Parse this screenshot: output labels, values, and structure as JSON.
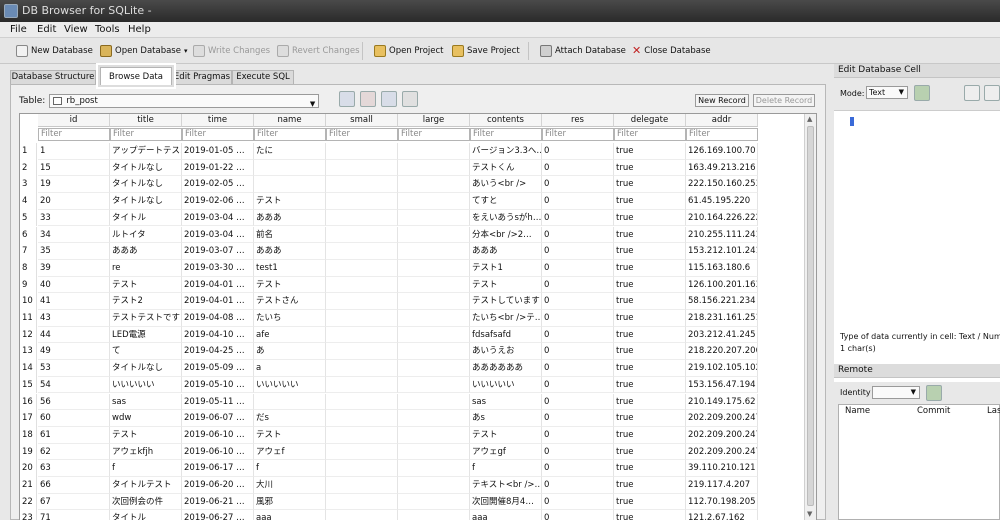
{
  "window": {
    "title": "DB Browser for SQLite -"
  },
  "menu": [
    "File",
    "Edit",
    "View",
    "Tools",
    "Help"
  ],
  "toolbar": {
    "new_db": "New Database",
    "open_db": "Open Database",
    "write_changes": "Write Changes",
    "revert_changes": "Revert Changes",
    "open_project": "Open Project",
    "save_project": "Save Project",
    "attach_db": "Attach Database",
    "close_db": "Close Database"
  },
  "tabs": [
    "Database Structure",
    "Browse Data",
    "Edit Pragmas",
    "Execute SQL"
  ],
  "browse": {
    "table_label": "Table:",
    "table_name": "rb_post",
    "new_record": "New Record",
    "delete_record": "Delete Record",
    "filter_placeholder": "Filter",
    "columns": [
      "id",
      "title",
      "time",
      "name",
      "small",
      "large",
      "contents",
      "res",
      "delegate",
      "addr"
    ],
    "rows": [
      [
        "1",
        "1",
        "アップデートテス…",
        "2019-01-05 …",
        "たに",
        "",
        "",
        "バージョン3.3へ…",
        "0",
        "true",
        "126.169.100.70"
      ],
      [
        "2",
        "15",
        "タイトルなし",
        "2019-01-22 …",
        "",
        "",
        "",
        "テストくん",
        "0",
        "true",
        "163.49.213.216"
      ],
      [
        "3",
        "19",
        "タイトルなし",
        "2019-02-05 …",
        "",
        "",
        "",
        "あいう<br />",
        "0",
        "true",
        "222.150.160.253"
      ],
      [
        "4",
        "20",
        "タイトルなし",
        "2019-02-06 …",
        "テスト",
        "",
        "",
        "てすと",
        "0",
        "true",
        "61.45.195.220"
      ],
      [
        "5",
        "33",
        "タイトル",
        "2019-03-04 …",
        "あああ",
        "",
        "",
        "をえいあうsがh…",
        "0",
        "true",
        "210.164.226.222"
      ],
      [
        "6",
        "34",
        "ルトイタ",
        "2019-03-04 …",
        "前名",
        "",
        "",
        "分本<br />2…",
        "0",
        "true",
        "210.255.111.241"
      ],
      [
        "7",
        "35",
        "あああ",
        "2019-03-07 …",
        "あああ",
        "",
        "",
        "あああ",
        "0",
        "true",
        "153.212.101.241"
      ],
      [
        "8",
        "39",
        "re",
        "2019-03-30 …",
        "test1",
        "",
        "",
        "テスト1",
        "0",
        "true",
        "115.163.180.6"
      ],
      [
        "9",
        "40",
        "テスト",
        "2019-04-01 …",
        "テスト",
        "",
        "",
        "テスト",
        "0",
        "true",
        "126.100.201.163"
      ],
      [
        "10",
        "41",
        "テスト2",
        "2019-04-01 …",
        "テストさん",
        "",
        "",
        "テストしています",
        "0",
        "true",
        "58.156.221.234"
      ],
      [
        "11",
        "43",
        "テストテストですと",
        "2019-04-08 …",
        "たいち",
        "",
        "",
        "たいち<br />テ…",
        "0",
        "true",
        "218.231.161.251"
      ],
      [
        "12",
        "44",
        "LED電源",
        "2019-04-10 …",
        "afe",
        "",
        "",
        "fdsafsafd",
        "0",
        "true",
        "203.212.41.245"
      ],
      [
        "13",
        "49",
        "て",
        "2019-04-25 …",
        "あ",
        "",
        "",
        "あいうえお",
        "0",
        "true",
        "218.220.207.206"
      ],
      [
        "14",
        "53",
        "タイトルなし",
        "2019-05-09 …",
        "a",
        "",
        "",
        "ああああああ",
        "0",
        "true",
        "219.102.105.102"
      ],
      [
        "15",
        "54",
        "いいいいい",
        "2019-05-10 …",
        "いいいいい",
        "",
        "",
        "いいいいい",
        "0",
        "true",
        "153.156.47.194"
      ],
      [
        "16",
        "56",
        "sas",
        "2019-05-11 …",
        "",
        "",
        "",
        "sas",
        "0",
        "true",
        "210.149.175.62"
      ],
      [
        "17",
        "60",
        "wdw",
        "2019-06-07 …",
        "だs",
        "",
        "",
        "あs",
        "0",
        "true",
        "202.209.200.247"
      ],
      [
        "18",
        "61",
        "テスト",
        "2019-06-10 …",
        "テスト",
        "",
        "",
        "テスト",
        "0",
        "true",
        "202.209.200.247"
      ],
      [
        "19",
        "62",
        "アウェkfjh",
        "2019-06-10 …",
        "アウェf",
        "",
        "",
        "アウェgf",
        "0",
        "true",
        "202.209.200.247"
      ],
      [
        "20",
        "63",
        "f",
        "2019-06-17 …",
        "f",
        "",
        "",
        "f",
        "0",
        "true",
        "39.110.210.121"
      ],
      [
        "21",
        "66",
        "タイトルテスト",
        "2019-06-20 …",
        "大川",
        "",
        "",
        "テキスト<br />…",
        "0",
        "true",
        "219.117.4.207"
      ],
      [
        "22",
        "67",
        "次回例会の件",
        "2019-06-21 …",
        "風邪",
        "",
        "",
        "次回開催8月4…",
        "0",
        "true",
        "112.70.198.205"
      ],
      [
        "23",
        "71",
        "タイトル",
        "2019-06-27 …",
        "aaa",
        "",
        "",
        "aaa",
        "0",
        "true",
        "121.2.67.162"
      ]
    ]
  },
  "edit_cell": {
    "title": "Edit Database Cell",
    "mode_label": "Mode:",
    "mode_value": "Text",
    "type_info": "Type of data currently in cell: Text / Nume",
    "size_info": "1 char(s)"
  },
  "remote": {
    "title": "Remote",
    "identity_label": "Identity",
    "columns": [
      "Name",
      "Commit",
      "Las"
    ]
  }
}
